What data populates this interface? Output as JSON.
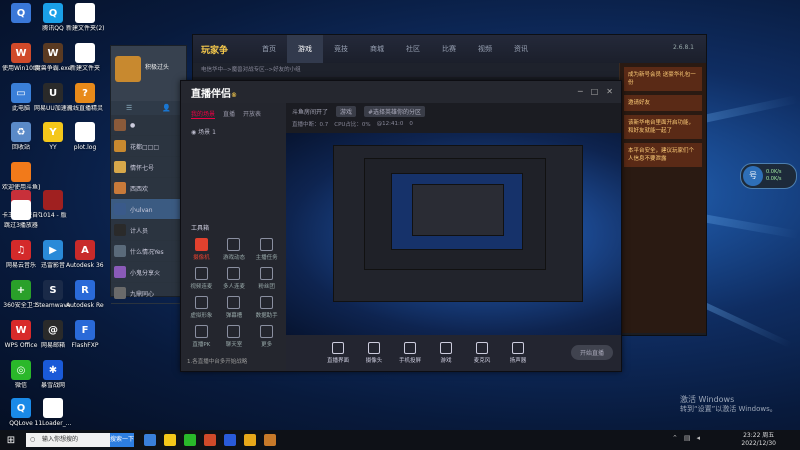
{
  "desktop": {
    "icons": [
      {
        "label": "",
        "color": "#3a78d8",
        "glyph": "Q"
      },
      {
        "label": "腾讯QQ",
        "color": "#1aa0e8",
        "glyph": "Q"
      },
      {
        "label": "新建文件夹(2)",
        "color": "#ffffff",
        "glyph": ""
      },
      {
        "label": "使用Win10维护",
        "color": "#d04a2a",
        "glyph": "W"
      },
      {
        "label": "魔兽争霸.exe",
        "color": "#5a3a22",
        "glyph": "W"
      },
      {
        "label": "新建文件夹",
        "color": "#ffffff",
        "glyph": ""
      },
      {
        "label": "此电脑",
        "color": "#3a7fd8",
        "glyph": "▭"
      },
      {
        "label": "网易UU加速器",
        "color": "#2a2a2a",
        "glyph": "U"
      },
      {
        "label": "火线直播精灵",
        "color": "#e88a1a",
        "glyph": "?"
      },
      {
        "label": "回收站",
        "color": "#5a8ac8",
        "glyph": "♻"
      },
      {
        "label": "YY",
        "color": "#f4c71a",
        "glyph": "Y"
      },
      {
        "label": "plot.log",
        "color": "#ffffff",
        "glyph": ""
      },
      {
        "label": "欢迎使用斗鱼直播助手",
        "color": "#f27a1a",
        "glyph": ""
      },
      {
        "label": "卡王城免费自带官方挂机清风",
        "color": "#c8303a",
        "glyph": ""
      },
      {
        "label": "跳过3播放器",
        "color": "#ffffff",
        "glyph": ""
      },
      {
        "label": "1014 - 版",
        "color": "#a02020",
        "glyph": ""
      },
      {
        "label": "网易云音乐",
        "color": "#d42a2a",
        "glyph": "♫"
      },
      {
        "label": "迅雷影音",
        "color": "#2a8ad8",
        "glyph": "▶"
      },
      {
        "label": "Autodesk 360",
        "color": "#c82a2a",
        "glyph": "A"
      },
      {
        "label": "360安全卫士",
        "color": "#2aa02a",
        "glyph": "+"
      },
      {
        "label": "Steamwave",
        "color": "#1a2a48",
        "glyph": "S"
      },
      {
        "label": "Autodesk ReCap",
        "color": "#2a6ad8",
        "glyph": "R"
      },
      {
        "label": "WPS Office",
        "color": "#d82a2a",
        "glyph": "W"
      },
      {
        "label": "网易邮箱",
        "color": "#2a2a2a",
        "glyph": "@"
      },
      {
        "label": "FlashFXP",
        "color": "#2a6ad8",
        "glyph": "F"
      },
      {
        "label": "微信",
        "color": "#2ab82a",
        "glyph": "◎"
      },
      {
        "label": "暴雪战网",
        "color": "#1a5ad8",
        "glyph": "✱"
      },
      {
        "label": "QQLove",
        "color": "#1a8ae8",
        "glyph": "Q"
      },
      {
        "label": "11Loader_...",
        "color": "#ffffff",
        "glyph": ""
      }
    ]
  },
  "qq_window": {
    "nickname": "积极过头",
    "tabs": [
      "☰",
      "👤"
    ],
    "contacts": [
      {
        "name": "●",
        "color": "#8a5a3a"
      },
      {
        "name": "花都□□□",
        "color": "#c8892f"
      },
      {
        "name": "情怀七号",
        "color": "#d8a84a"
      },
      {
        "name": "西西欢",
        "color": "#c87a3a"
      },
      {
        "name": "小ulvan",
        "color": "#3a5a8a",
        "selected": true
      },
      {
        "name": "计人员",
        "color": "#2a2a2a"
      },
      {
        "name": "什么情况Yes",
        "color": "#5a6a7a"
      },
      {
        "name": "小鬼分享火",
        "color": "#8a5ab8"
      },
      {
        "name": "九鼎同心",
        "color": "#6a6a6a"
      }
    ]
  },
  "game_client": {
    "logo": "玩家争",
    "nav": [
      "首页",
      "游戏",
      "竞技",
      "商城",
      "社区",
      "比赛",
      "视频",
      "资讯"
    ],
    "active_nav": "游戏",
    "breadcrumb": "电信华中-->魔兽对战专区-->好友的小组",
    "version": "2.6.8.1",
    "promo_cards": [
      "成为新号会员 送豪华礼包一份",
      "邀请好友",
      "该新华电台里面开启功能，和好友就能一起了",
      "本平台安全，建议玩家们个人信息不要泄露"
    ]
  },
  "stream_window": {
    "logo": "直播伴侣",
    "logo_badge": "®",
    "left_tabs": [
      "我的场景",
      "直播",
      "开放表"
    ],
    "active_left_tab": "我的场景",
    "scene_name": "场景 1",
    "tools_title": "工具箱",
    "tools": [
      {
        "label": "摄像机",
        "red": true
      },
      {
        "label": "游戏动态",
        "red": false
      },
      {
        "label": "主播任务",
        "red": false
      },
      {
        "label": "视频连麦",
        "red": false
      },
      {
        "label": "多人连麦",
        "red": false
      },
      {
        "label": "粉丝团",
        "red": false
      },
      {
        "label": "虚拟形象",
        "red": false
      },
      {
        "label": "弹幕槽",
        "red": false
      },
      {
        "label": "数据助手",
        "red": false
      },
      {
        "label": "直播PK",
        "red": false
      },
      {
        "label": "聊天室",
        "red": false
      },
      {
        "label": "更多",
        "red": false
      }
    ],
    "status_text": "1.各直播中台多开始战略",
    "infobar": {
      "title": "斗鱼房间开了",
      "tag": "游戏",
      "category": "#选择英雄你的分区"
    },
    "stats": {
      "bitrate": "直播中断：0.7",
      "cpu": "CPU占比：0%",
      "time": "@12:41:0",
      "viewers": "0"
    },
    "bottom_buttons": [
      "直播界面",
      "摄像头",
      "手机投屏",
      "游戏",
      "麦克风",
      "扬声器"
    ],
    "go_live": "开始直播"
  },
  "widget": {
    "glyph": "号",
    "line1": "0.0K/s",
    "line2": "0.0K/s"
  },
  "activation": {
    "title": "激活 Windows",
    "subtitle": "转到“设置”以激活 Windows。"
  },
  "taskbar": {
    "start_glyph": "⊞",
    "search_placeholder": "输入你想搜的",
    "search_button": "搜索一下",
    "icon_colors": [
      "#3a7fd8",
      "#f4c71a",
      "#2ab82a",
      "#d04a2a",
      "#2a5ad8",
      "#e8a81a",
      "#c87a2a"
    ],
    "time": "23:22 周五",
    "date": "2022/12/30"
  }
}
